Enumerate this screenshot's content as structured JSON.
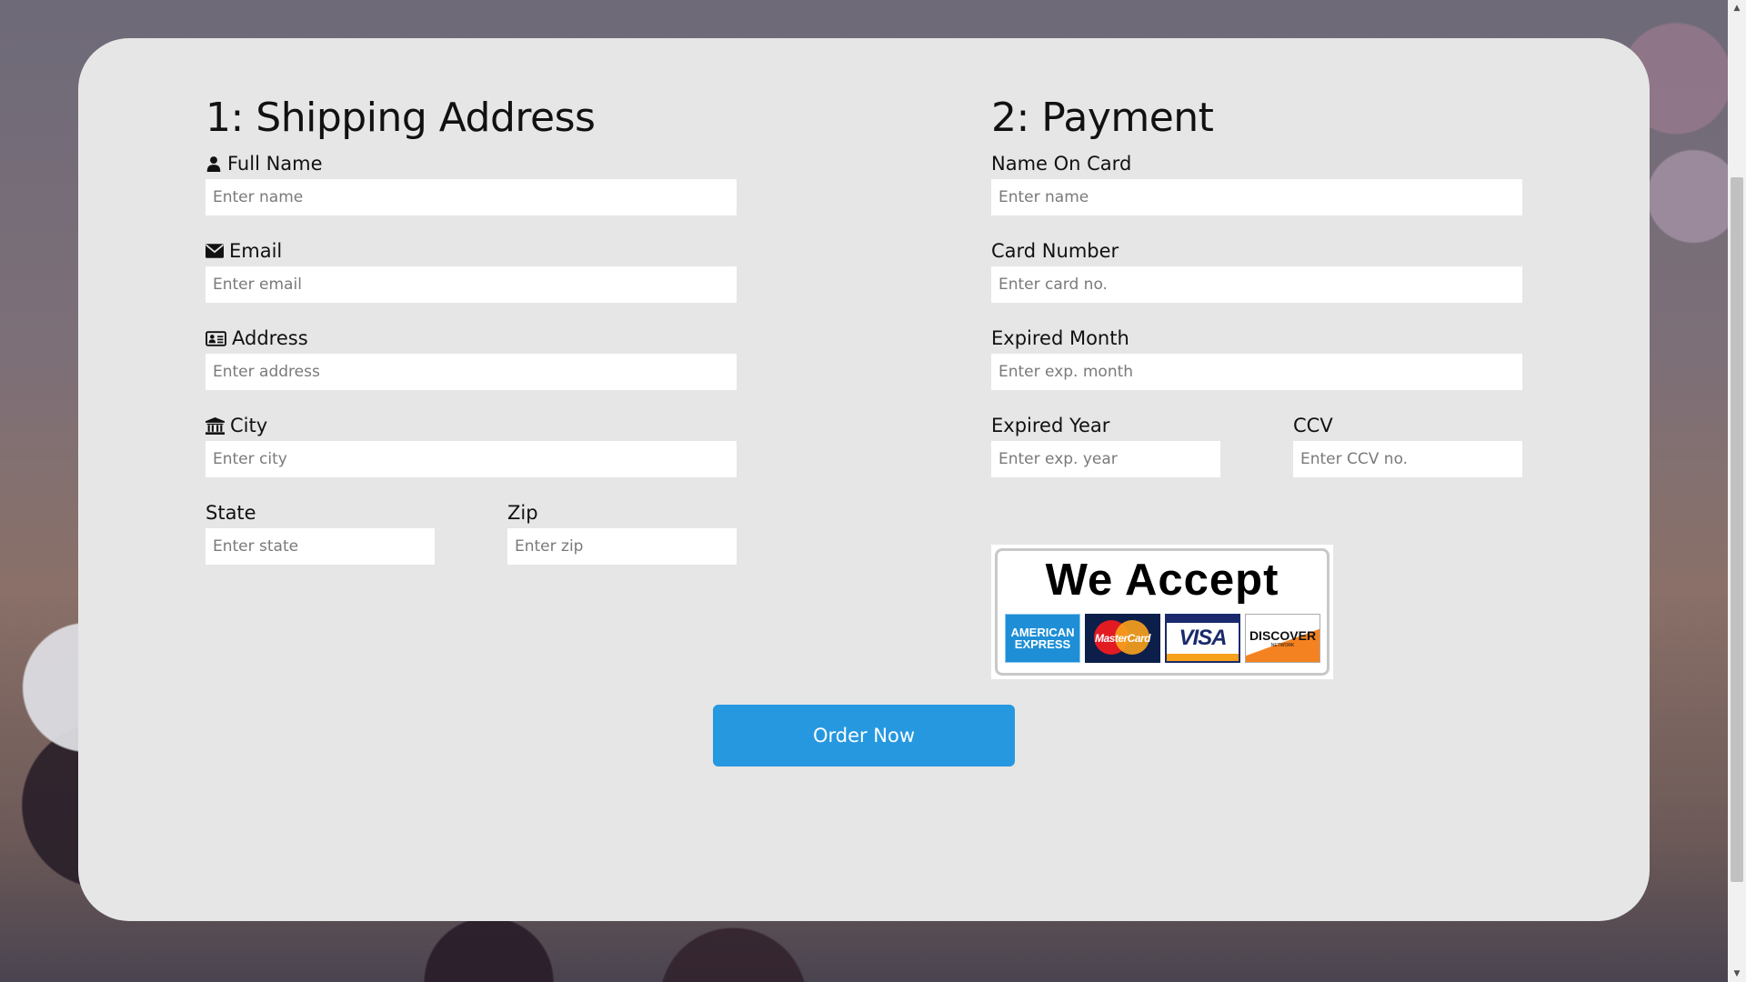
{
  "shipping": {
    "title": "1: Shipping Address",
    "full_name": {
      "label": "Full Name",
      "placeholder": "Enter name",
      "icon": "user-icon"
    },
    "email": {
      "label": "Email",
      "placeholder": "Enter email",
      "icon": "envelope-icon"
    },
    "address": {
      "label": "Address",
      "placeholder": "Enter address",
      "icon": "address-card-icon"
    },
    "city": {
      "label": "City",
      "placeholder": "Enter city",
      "icon": "institution-icon"
    },
    "state": {
      "label": "State",
      "placeholder": "Enter state"
    },
    "zip": {
      "label": "Zip",
      "placeholder": "Enter zip"
    }
  },
  "payment": {
    "title": "2: Payment",
    "name_on_card": {
      "label": "Name On Card",
      "placeholder": "Enter name"
    },
    "card_number": {
      "label": "Card Number",
      "placeholder": "Enter card no."
    },
    "expired_month": {
      "label": "Expired Month",
      "placeholder": "Enter exp. month"
    },
    "expired_year": {
      "label": "Expired Year",
      "placeholder": "Enter exp. year"
    },
    "ccv": {
      "label": "CCV",
      "placeholder": "Enter CCV no."
    },
    "accept_badge": {
      "title": "We Accept",
      "amex_line1": "AMERICAN",
      "amex_line2": "EXPRESS",
      "mastercard": "MasterCard",
      "visa": "VISA",
      "discover": "DISCOVER",
      "discover_sub": "NETWORK"
    }
  },
  "order_button": {
    "label": "Order Now"
  },
  "colors": {
    "card_bg": "#e6e6e6",
    "button_bg": "#2698e0",
    "button_text": "#ffffff"
  }
}
